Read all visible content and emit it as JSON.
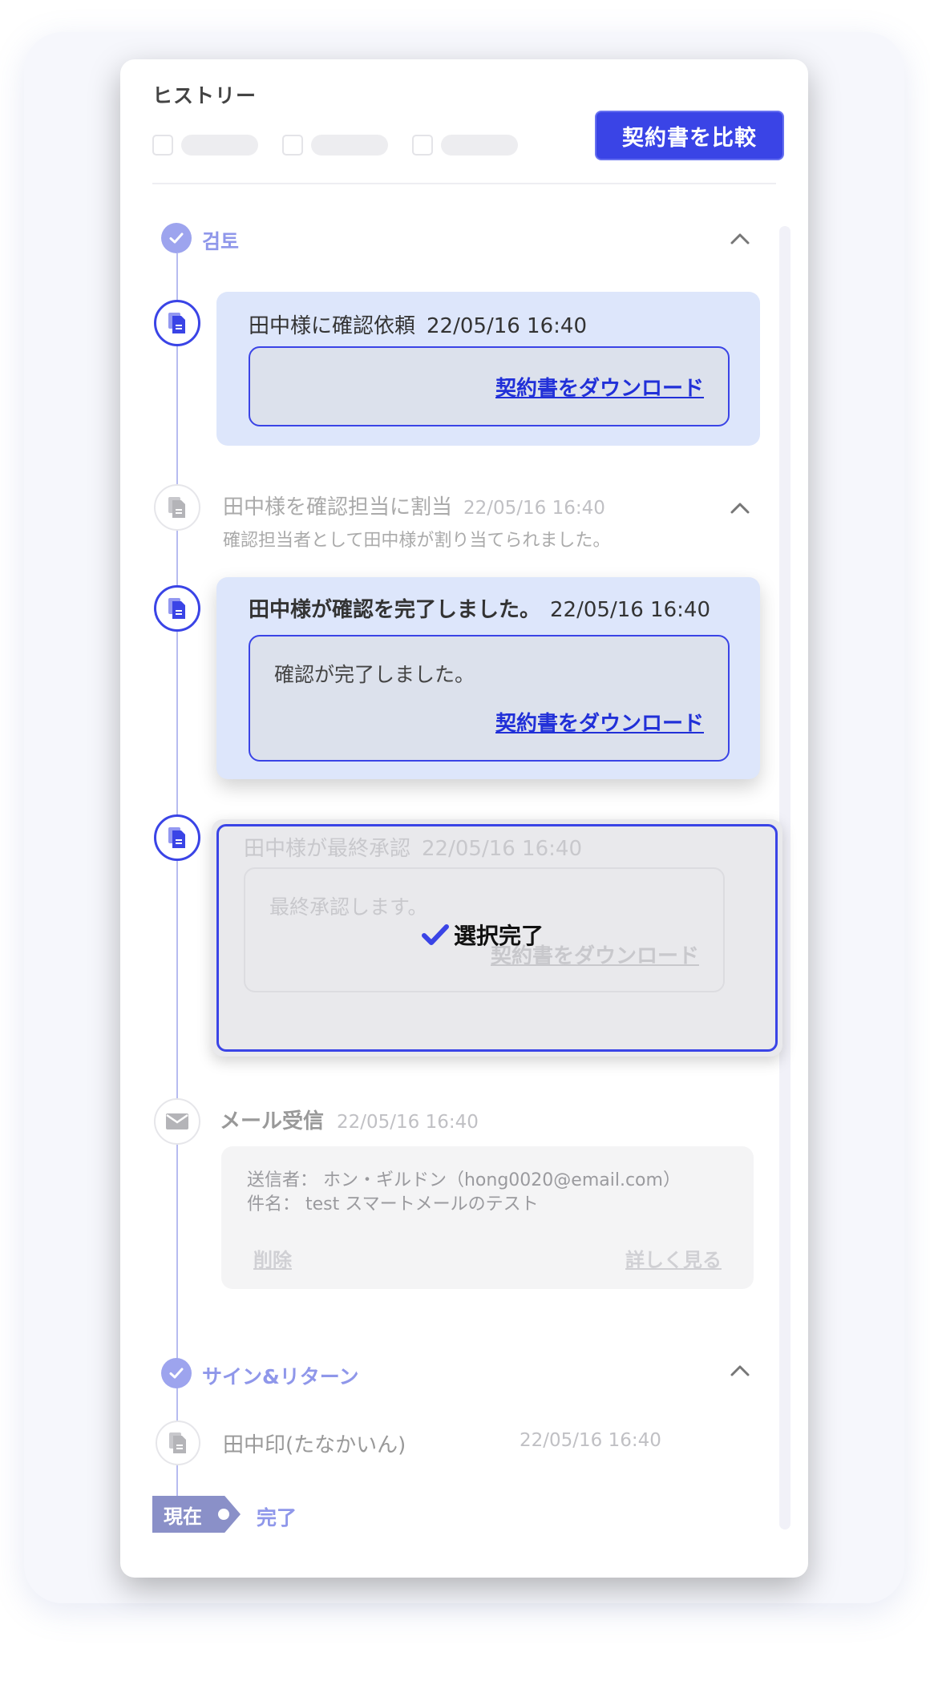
{
  "panel": {
    "title": "ヒストリー",
    "compare_button": "契約書を比較"
  },
  "sections": [
    {
      "label": "검토"
    },
    {
      "label": "サイン&リターン"
    }
  ],
  "events": {
    "e1": {
      "title": "田中様に確認依頼",
      "time": "22/05/16 16:40",
      "download": "契約書をダウンロード"
    },
    "e2": {
      "title": "田中様を確認担当に割当",
      "time": "22/05/16 16:40",
      "desc": "確認担当者として田中様が割り当てられました。"
    },
    "e3": {
      "title": "田中様が確認を完了しました。",
      "time": "22/05/16 16:40",
      "message": "確認が完了しました。",
      "download": "契約書をダウンロード"
    },
    "e4": {
      "title": "田中様が最終承認",
      "time": "22/05/16 16:40",
      "message": "最終承認します。",
      "download": "契約書をダウンロード",
      "overlay": "選択完了"
    },
    "e5": {
      "title": "メール受信",
      "time": "22/05/16 16:40",
      "sender": "送信者： ホン・ギルドン（hong0020@email.com）",
      "subject": "件名： test スマートメールのテスト",
      "delete": "削除",
      "details": "詳しく見る"
    },
    "e6": {
      "title": "田中印(たなかいん)",
      "time": "22/05/16 16:40"
    }
  },
  "footer": {
    "now_label": "現在",
    "status": "完了"
  },
  "colors": {
    "accent": "#3a44e6",
    "accent_soft": "#9da4ee",
    "card_blue": "#dde6fb"
  }
}
